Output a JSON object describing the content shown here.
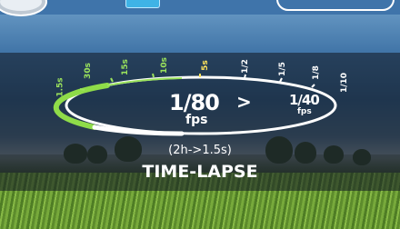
{
  "ticks": [
    {
      "label": "1.5s",
      "color": "#9be35c"
    },
    {
      "label": "30s",
      "color": "#9be35c"
    },
    {
      "label": "15s",
      "color": "#9be35c"
    },
    {
      "label": "10s",
      "color": "#9be35c"
    },
    {
      "label": "5s",
      "color": "#ffe45c"
    },
    {
      "label": "1/2",
      "color": "#ffffff"
    },
    {
      "label": "1/5",
      "color": "#ffffff"
    },
    {
      "label": "1/8",
      "color": "#ffffff"
    },
    {
      "label": "1/10",
      "color": "#ffffff"
    }
  ],
  "speed": {
    "current": "1/80",
    "current_unit": "fps",
    "arrow": ">",
    "next": "1/40",
    "next_unit": "fps"
  },
  "duration": "(2h->1.5s)",
  "mode": "TIME-LAPSE",
  "colors": {
    "accent": "#9be35c",
    "selected": "#ffe45c",
    "top_highlight": "#3fb3e6"
  }
}
